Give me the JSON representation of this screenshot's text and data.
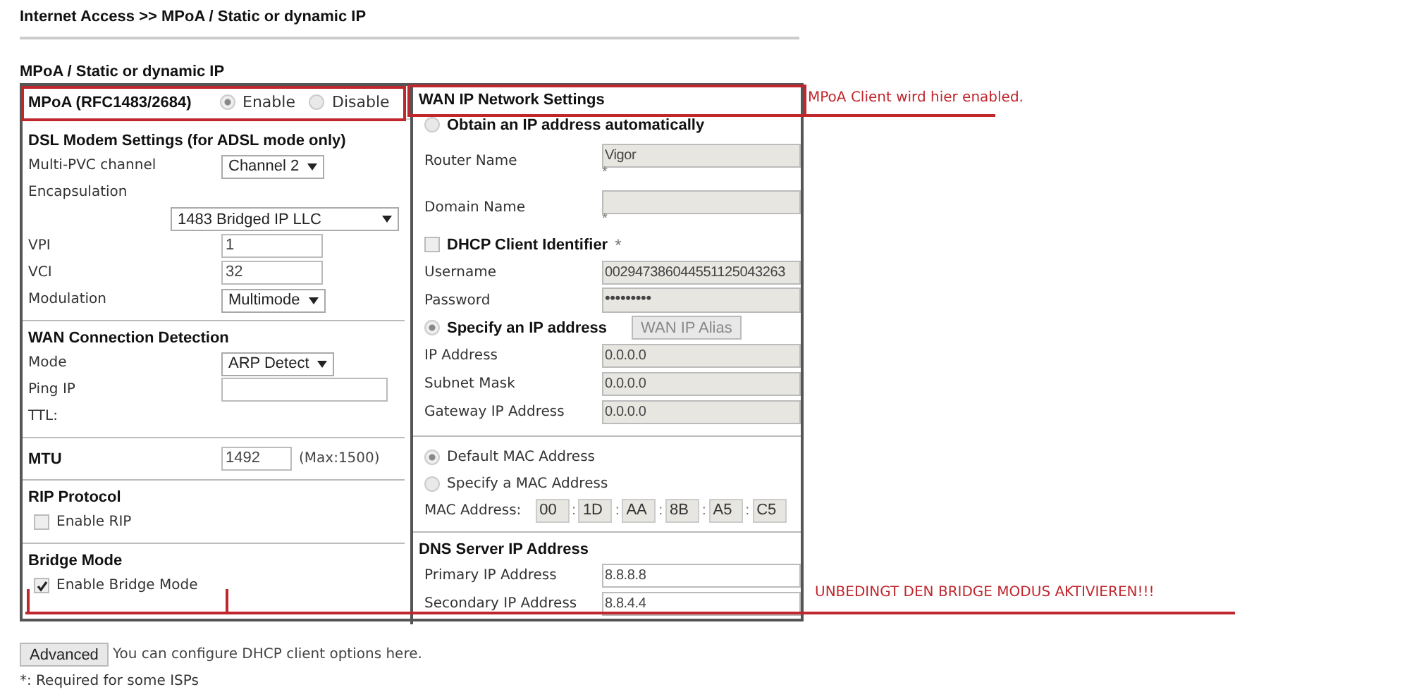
{
  "breadcrumb": "Internet Access >> MPoA / Static or dynamic IP",
  "section_title": "MPoA / Static or dynamic IP",
  "mpoa": {
    "label": "MPoA (RFC1483/2684)",
    "options": [
      {
        "label": "Enable",
        "selected": true
      },
      {
        "label": "Disable",
        "selected": false
      }
    ]
  },
  "left_sections": [
    {
      "title": "DSL Modem Settings (for ADSL mode only)",
      "rows": [
        {
          "kind": "select",
          "label": "Multi-PVC channel",
          "value": "Channel 2"
        },
        {
          "kind": "label",
          "label": "Encapsulation"
        },
        {
          "kind": "wide-select",
          "value": "1483 Bridged IP LLC"
        },
        {
          "kind": "input",
          "label": "VPI",
          "value": "1"
        },
        {
          "kind": "input",
          "label": "VCI",
          "value": "32"
        },
        {
          "kind": "select",
          "label": "Modulation",
          "value": "Multimode"
        }
      ]
    },
    {
      "title": "WAN Connection Detection",
      "rows": [
        {
          "kind": "select",
          "label": "Mode",
          "value": "ARP Detect"
        },
        {
          "kind": "input",
          "label": "Ping IP"
        },
        {
          "kind": "label",
          "label": "TTL:"
        }
      ]
    },
    {
      "rows": [
        {
          "kind": "heading-input",
          "label": "MTU",
          "value": "1492",
          "note": "(Max:1500)"
        }
      ]
    },
    {
      "title": "RIP Protocol",
      "rows": [
        {
          "kind": "checkbox",
          "label": "Enable RIP",
          "checked": false
        }
      ]
    },
    {
      "title": "Bridge Mode",
      "rows": [
        {
          "kind": "checkbox",
          "label": "Enable Bridge Mode",
          "checked": true
        }
      ]
    }
  ],
  "right_sections": [
    {
      "title": "WAN IP Network Settings",
      "rows": [
        {
          "kind": "radio-heading",
          "label": "Obtain an IP address automatically",
          "selected": false
        },
        {
          "kind": "field",
          "label": "Router Name",
          "value": "Vigor",
          "disabled": true,
          "note": "*"
        },
        {
          "kind": "field",
          "label": "Domain Name",
          "disabled": true,
          "note": "*"
        },
        {
          "kind": "checkbox-heading",
          "label": "DHCP Client Identifier",
          "suffix": "*",
          "checked": false
        },
        {
          "kind": "field",
          "label": "Username",
          "value": "002947386044551125043263",
          "disabled": true
        },
        {
          "kind": "password",
          "label": "Password",
          "value": "•••••••••",
          "disabled": true
        },
        {
          "kind": "radio-heading",
          "label": "Specify an IP address",
          "selected": true,
          "button": "WAN IP Alias"
        },
        {
          "kind": "field",
          "label": "IP Address",
          "value": "0.0.0.0",
          "disabled": true
        },
        {
          "kind": "field",
          "label": "Subnet Mask",
          "value": "0.0.0.0",
          "disabled": true
        },
        {
          "kind": "field",
          "label": "Gateway IP Address",
          "value": "0.0.0.0",
          "disabled": true
        }
      ]
    },
    {
      "rows": [
        {
          "kind": "radio",
          "label": "Default MAC Address",
          "selected": true
        },
        {
          "kind": "radio",
          "label": "Specify a MAC Address",
          "selected": false
        },
        {
          "kind": "mac",
          "label": "MAC Address:",
          "octets": [
            {
              "value": "00"
            },
            {
              "sep": ":",
              "value": "1D"
            },
            {
              "sep": ":",
              "value": "AA"
            },
            {
              "sep": ":",
              "value": "8B"
            },
            {
              "sep": ":",
              "value": "A5"
            },
            {
              "sep": ":",
              "value": "C5"
            }
          ]
        }
      ]
    },
    {
      "title": "DNS Server IP Address",
      "rows": [
        {
          "kind": "field",
          "label": "Primary IP Address",
          "value": "8.8.8.8",
          "disabled": false
        },
        {
          "kind": "field",
          "label": "Secondary IP Address",
          "value": "8.8.4.4",
          "disabled": false
        }
      ]
    }
  ],
  "footer": {
    "button": "Advanced",
    "hint": "You can configure DHCP client options here.",
    "note": "*: Required for some ISPs"
  },
  "annotations": [
    {
      "kind": "mpoa",
      "text": "MPoA Client wird hier enabled."
    },
    {
      "kind": "bridge",
      "text": "UNBEDINGT DEN BRIDGE MODUS AKTIVIEREN!!!"
    }
  ]
}
